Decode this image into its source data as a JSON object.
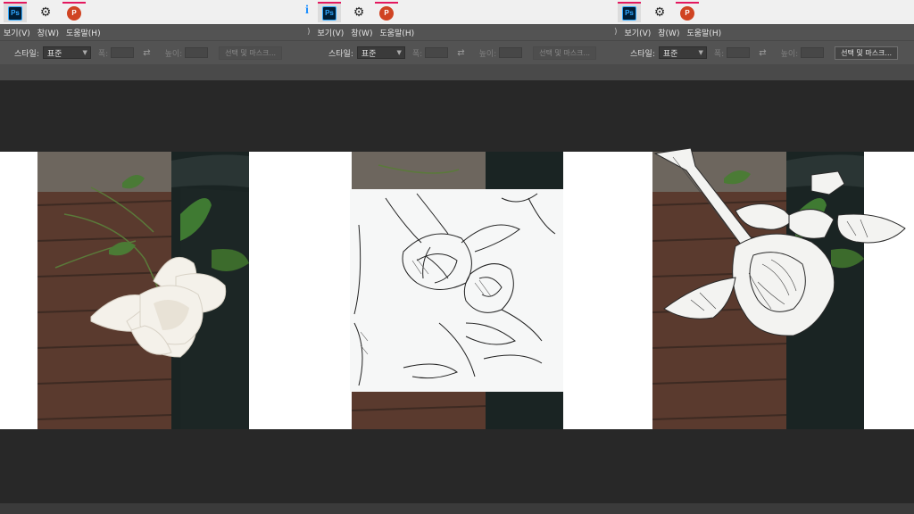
{
  "panels": [
    {
      "menu": {
        "view": "보기(V)",
        "window": "창(W)",
        "help": "도움말(H)"
      },
      "options": {
        "style_label": "스타일:",
        "style_value": "표준",
        "width_label": "폭:",
        "height_label": "높이:",
        "mask_button": "선택 및 마스크..."
      }
    },
    {
      "menu": {
        "prefix": ")",
        "view": "보기(V)",
        "window": "창(W)",
        "help": "도움말(H)"
      },
      "options": {
        "style_label": "스타일:",
        "style_value": "표준",
        "width_label": "폭:",
        "height_label": "높이:",
        "mask_button": "선택 및 마스크..."
      }
    },
    {
      "menu": {
        "prefix": ")",
        "view": "보기(V)",
        "window": "창(W)",
        "help": "도움말(H)"
      },
      "options": {
        "style_label": "스타일:",
        "style_value": "표준",
        "width_label": "폭:",
        "height_label": "높이:",
        "mask_button": "선택 및 마스크..."
      }
    }
  ],
  "taskbar": {
    "ps_label": "Ps",
    "ppt_label": "P",
    "info_label": "i"
  },
  "colors": {
    "menubar": "#535353",
    "workspace": "#282828",
    "accent": "#e3185e",
    "ps_blue": "#31a8ff"
  },
  "icons": [
    "photoshop-icon",
    "gear-icon",
    "powerpoint-icon",
    "info-icon",
    "swap-arrows-icon",
    "chevron-down-icon"
  ]
}
